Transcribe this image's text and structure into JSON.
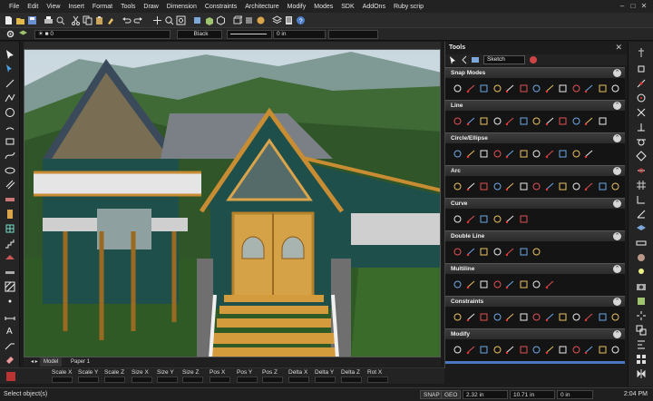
{
  "menu": [
    "File",
    "Edit",
    "View",
    "Insert",
    "Format",
    "Tools",
    "Draw",
    "Dimension",
    "Constraints",
    "Architecture",
    "Modify",
    "Modes",
    "SDK",
    "AddOns",
    "Ruby scrip"
  ],
  "toolbar2": {
    "layer_value": "0",
    "color_value": "Black",
    "width_value": "0 in"
  },
  "viewport_tabs": {
    "model": "Model",
    "paper": "Paper 1"
  },
  "transform_fields": [
    "Scale X",
    "Scale Y",
    "Scale Z",
    "Size X",
    "Size Y",
    "Size Z",
    "Pos X",
    "Pos Y",
    "Pos Z",
    "Delta X",
    "Delta Y",
    "Delta Z",
    "Rot X"
  ],
  "tools_panel": {
    "title": "Tools",
    "workspace": "Sketch",
    "sections": [
      {
        "label": "Snap Modes",
        "icons": 13
      },
      {
        "label": "Line",
        "icons": 12
      },
      {
        "label": "Circle/Ellipse",
        "icons": 11
      },
      {
        "label": "Arc",
        "icons": 13
      },
      {
        "label": "Curve",
        "icons": 6
      },
      {
        "label": "Double Line",
        "icons": 7
      },
      {
        "label": "Multiline",
        "icons": 8
      },
      {
        "label": "Constraints",
        "icons": 13
      },
      {
        "label": "Modify",
        "icons": 13
      }
    ]
  },
  "status": {
    "message": "Select object(s)",
    "snap": "SNAP",
    "geo": "GEO",
    "coord_1": "2.32 in",
    "coord_2": "10.71 in",
    "coord_3": "0 in",
    "time": "2:04 PM"
  },
  "colors": {
    "accent": "#c8a030",
    "panel": "#1c1c1c",
    "section_header": "#353535"
  }
}
